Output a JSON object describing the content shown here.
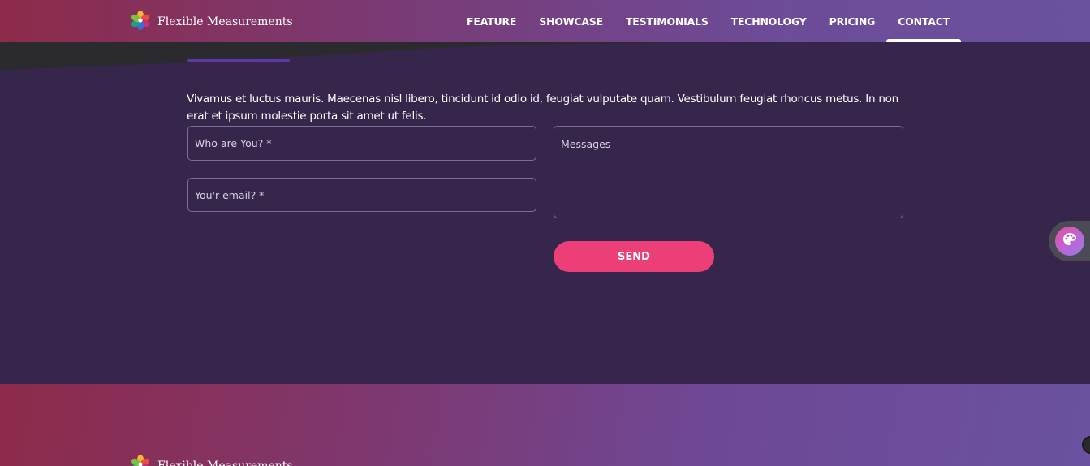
{
  "brand": {
    "name": "Flexible Measurements",
    "logo_icon": "flower-logo-icon"
  },
  "nav": {
    "items": [
      {
        "label": "FEATURE"
      },
      {
        "label": "SHOWCASE"
      },
      {
        "label": "TESTIMONIALS"
      },
      {
        "label": "TECHNOLOGY"
      },
      {
        "label": "PRICING"
      },
      {
        "label": "CONTACT",
        "active": true
      }
    ]
  },
  "contact": {
    "intro": "Vivamus et luctus mauris. Maecenas nisl libero, tincidunt id odio id, feugiat vulputate quam. Vestibulum feugiat rhoncus metus. In non erat et ipsum molestie porta sit amet ut felis.",
    "name_placeholder": "Who are You? *",
    "email_placeholder": "You'r email? *",
    "message_placeholder": "Messages",
    "send_label": "SEND"
  },
  "theme_switcher": {
    "icon": "palette-icon"
  },
  "footer": {
    "logo_icon": "flower-logo-icon",
    "brand_name": "Flexible Measurements"
  },
  "colors": {
    "background": "#37264b",
    "accent": "#ec3f77",
    "nav_gradient_start": "#8e2a4a",
    "nav_gradient_end": "#6a52a0",
    "field_border": "#7c6f96"
  }
}
